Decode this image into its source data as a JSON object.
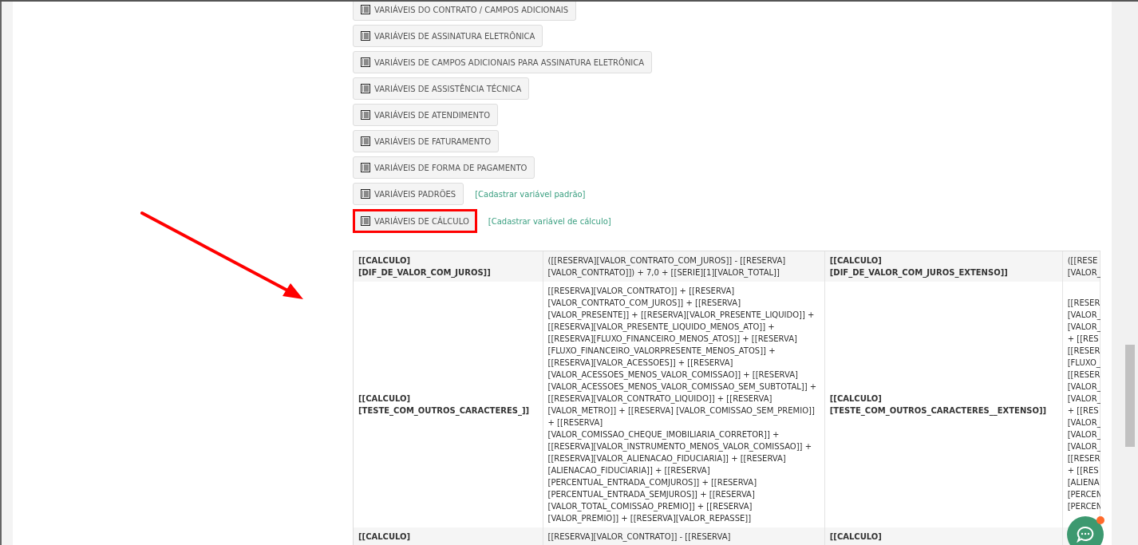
{
  "variable_groups": [
    {
      "label": "VARIÁVEIS DO CONTRATO / CAMPOS ADICIONAIS",
      "highlighted": false
    },
    {
      "label": "VARIÁVEIS DE ASSINATURA ELETRÔNICA",
      "highlighted": false
    },
    {
      "label": "VARIÁVEIS DE CAMPOS ADICIONAIS PARA ASSINATURA ELETRÔNICA",
      "highlighted": false
    },
    {
      "label": "VARIÁVEIS DE ASSISTÊNCIA TÉCNICA",
      "highlighted": false
    },
    {
      "label": "VARIÁVEIS DE ATENDIMENTO",
      "highlighted": false
    },
    {
      "label": "VARIÁVEIS DE FATURAMENTO",
      "highlighted": false
    },
    {
      "label": "VARIÁVEIS DE FORMA DE PAGAMENTO",
      "highlighted": false
    },
    {
      "label": "VARIÁVEIS PADRÕES",
      "highlighted": false,
      "link": "[Cadastrar variável padrão]"
    },
    {
      "label": "VARIÁVEIS DE CÁLCULO",
      "highlighted": true,
      "link": "[Cadastrar variável de cálculo]"
    }
  ],
  "table": {
    "rows": [
      {
        "column_1": "[[CALCULO] [DIF_DE_VALOR_COM_JUROS]]",
        "column_2": "([[RESERVA][VALOR_CONTRATO_COM_JUROS]] - [[RESERVA] [VALOR_CONTRATO]]) + 7,0 + [[SERIE][1][VALOR_TOTAL]]",
        "column_3": "[[CALCULO] [DIF_DE_VALOR_COM_JUROS_EXTENSO]]",
        "column_4": [
          "([[RESE",
          "[VALOR_"
        ]
      },
      {
        "column_1": "[[CALCULO] [TESTE_COM_OUTROS_CARACTERES_]]",
        "column_2": "[[RESERVA][VALOR_CONTRATO]] + [[RESERVA] [VALOR_CONTRATO_COM_JUROS]] + [[RESERVA] [VALOR_PRESENTE]] + [[RESERVA][VALOR_PRESENTE_LIQUIDO]] + [[RESERVA][VALOR_PRESENTE_LIQUIDO_MENOS_ATO]] + [[RESERVA][FLUXO_FINANCEIRO_MENOS_ATOS]] + [[RESERVA] [FLUXO_FINANCEIRO_VALORPRESENTE_MENOS_ATOS]] + [[RESERVA][VALOR_ACESSOES]] + [[RESERVA] [VALOR_ACESSOES_MENOS_VALOR_COMISSAO]] + [[RESERVA] [VALOR_ACESSOES_MENOS_VALOR_COMISSAO_SEM_SUBTOTAL]] + [[RESERVA][VALOR_CONTRATO_LIQUIDO]] + [[RESERVA] [VALOR_METRO]] + [[RESERVA] [VALOR_COMISSAO_SEM_PREMIO]] + [[RESERVA] [VALOR_COMISSAO_CHEQUE_IMOBILIARIA_CORRETOR]] + [[RESERVA][VALOR_INSTRUMENTO_MENOS_VALOR_COMISSAO]] + [[RESERVA][VALOR_ALIENACAO_FIDUCIARIA]] + [[RESERVA] [ALIENACAO_FIDUCIARIA]] + [[RESERVA] [PERCENTUAL_ENTRADA_COMJUROS]] + [[RESERVA] [PERCENTUAL_ENTRADA_SEMJUROS]] + [[RESERVA] [VALOR_TOTAL_COMISSAO_PREMIO]] + [[RESERVA] [VALOR_PREMIO]] + [[RESERVA][VALOR_REPASSE]]",
        "column_3": "[[CALCULO] [TESTE_COM_OUTROS_CARACTERES__EXTENSO]]",
        "column_4": [
          "[[RESER",
          "[VALOR_",
          "[VALOR_",
          "+ [[RES",
          "[[RESER",
          "[FLUXO_",
          "[[RESER",
          "[VALOR_",
          "[VALOR_",
          "+ [[RES",
          "[VALOR_",
          "[VALOR_",
          "[VALOR_",
          "[[RESER",
          "+ [[RES",
          "[ALIENA",
          "[PERCEN",
          "[PERCEN"
        ]
      },
      {
        "column_1": "[[CALCULO]",
        "column_2": "[[RESERVA][VALOR_CONTRATO]] - [[RESERVA]",
        "column_3": "[[CALCULO]",
        "column_4": []
      }
    ]
  }
}
